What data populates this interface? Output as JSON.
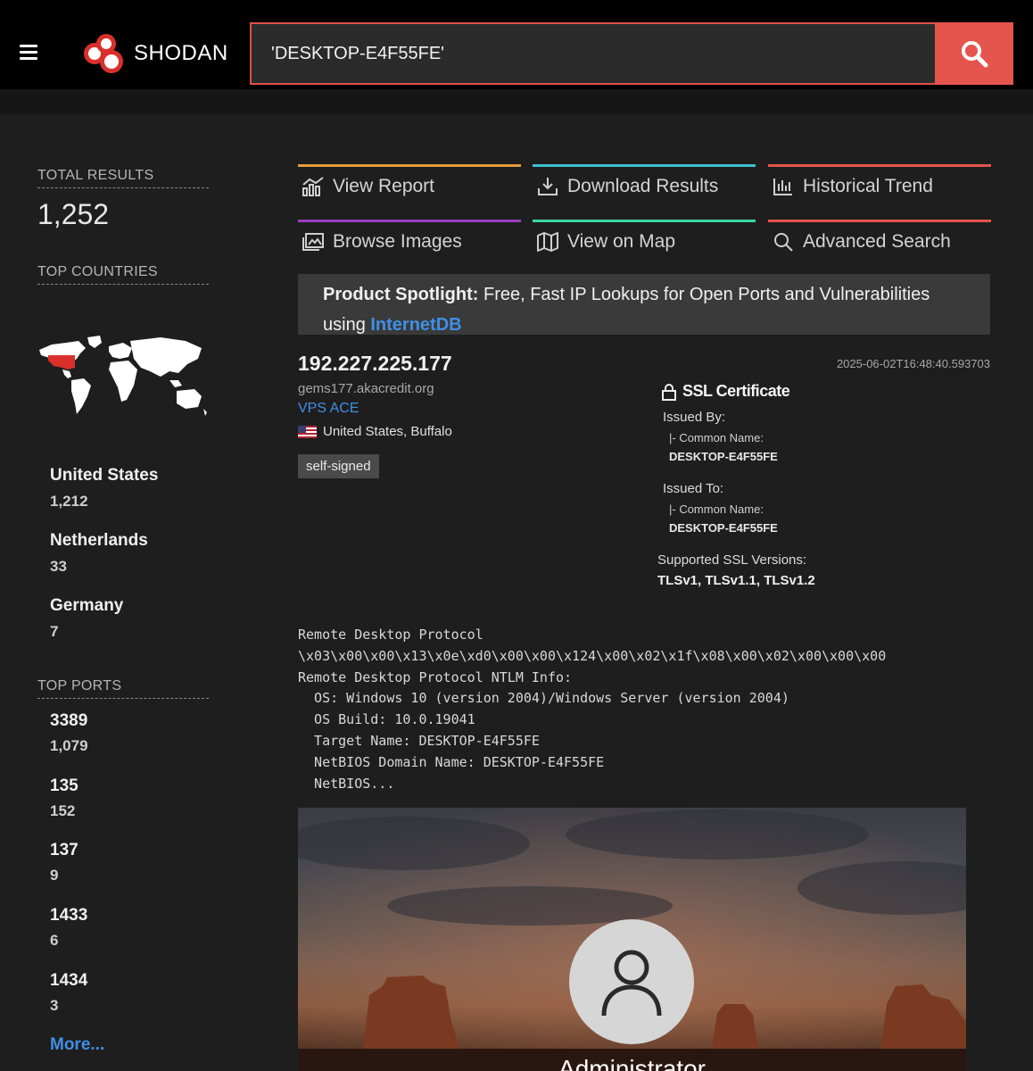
{
  "header": {
    "brand": "SHODAN",
    "search_value": "'DESKTOP-E4F55FE'"
  },
  "sidebar": {
    "total_results_label": "TOTAL RESULTS",
    "total_results_value": "1,252",
    "top_countries_label": "TOP COUNTRIES",
    "countries": [
      {
        "name": "United States",
        "count": "1,212"
      },
      {
        "name": "Netherlands",
        "count": "33"
      },
      {
        "name": "Germany",
        "count": "7"
      }
    ],
    "top_ports_label": "TOP PORTS",
    "ports": [
      {
        "port": "3389",
        "count": "1,079"
      },
      {
        "port": "135",
        "count": "152"
      },
      {
        "port": "137",
        "count": "9"
      },
      {
        "port": "1433",
        "count": "6"
      },
      {
        "port": "1434",
        "count": "3"
      }
    ],
    "more_label": "More..."
  },
  "actions": [
    {
      "label": "View Report",
      "color": "#e89b3c",
      "icon": "chart-icon"
    },
    {
      "label": "Download Results",
      "color": "#3ec1d3",
      "icon": "download-icon"
    },
    {
      "label": "Historical Trend",
      "color": "#e5544d",
      "icon": "bar-chart-icon"
    },
    {
      "label": "Browse Images",
      "color": "#9b3fc0",
      "icon": "images-icon"
    },
    {
      "label": "View on Map",
      "color": "#3ed3a0",
      "icon": "map-icon"
    },
    {
      "label": "Advanced Search",
      "color": "#e5544d",
      "icon": "search-icon"
    }
  ],
  "spotlight": {
    "prefix": "Product Spotlight:",
    "text_a": " Free, Fast IP Lookups for Open Ports and Vulnerabilities",
    "text_b": "using ",
    "link": "InternetDB"
  },
  "result": {
    "ip": "192.227.225.177",
    "timestamp": "2025-06-02T16:48:40.593703",
    "hostname": "gems177.akacredit.org",
    "org": "VPS ACE",
    "location": "United States, Buffalo",
    "tag": "self-signed"
  },
  "ssl": {
    "title": "SSL Certificate",
    "issued_by_label": "Issued By:",
    "issued_by_cn_label": "|- Common Name:",
    "issued_by_cn": "DESKTOP-E4F55FE",
    "issued_to_label": "Issued To:",
    "issued_to_cn_label": "|- Common Name:",
    "issued_to_cn": "DESKTOP-E4F55FE",
    "versions_label": "Supported SSL Versions:",
    "versions": "TLSv1, TLSv1.1, TLSv1.2"
  },
  "banner": [
    "Remote Desktop Protocol",
    "\\x03\\x00\\x00\\x13\\x0e\\xd0\\x00\\x00\\x124\\x00\\x02\\x1f\\x08\\x00\\x02\\x00\\x00\\x00",
    "Remote Desktop Protocol NTLM Info:",
    "  OS: Windows 10 (version 2004)/Windows Server (version 2004)",
    "  OS Build: 10.0.19041",
    "  Target Name: DESKTOP-E4F55FE",
    "  NetBIOS Domain Name: DESKTOP-E4F55FE",
    "  NetBIOS..."
  ],
  "screenshot": {
    "username": "Administrator"
  }
}
